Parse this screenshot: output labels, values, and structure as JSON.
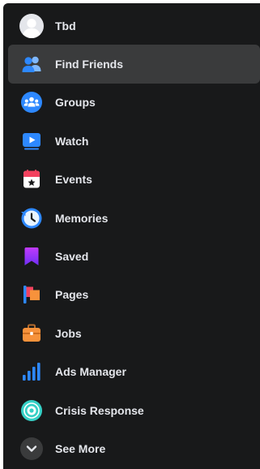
{
  "menu": {
    "items": [
      {
        "id": "profile",
        "label": "Tbd",
        "icon": "avatar"
      },
      {
        "id": "find-friends",
        "label": "Find Friends",
        "icon": "friends-icon"
      },
      {
        "id": "groups",
        "label": "Groups",
        "icon": "groups-icon"
      },
      {
        "id": "watch",
        "label": "Watch",
        "icon": "watch-icon"
      },
      {
        "id": "events",
        "label": "Events",
        "icon": "events-icon"
      },
      {
        "id": "memories",
        "label": "Memories",
        "icon": "memories-icon"
      },
      {
        "id": "saved",
        "label": "Saved",
        "icon": "saved-icon"
      },
      {
        "id": "pages",
        "label": "Pages",
        "icon": "pages-icon"
      },
      {
        "id": "jobs",
        "label": "Jobs",
        "icon": "jobs-icon"
      },
      {
        "id": "ads-manager",
        "label": "Ads Manager",
        "icon": "ads-manager-icon"
      },
      {
        "id": "crisis-response",
        "label": "Crisis Response",
        "icon": "crisis-response-icon"
      },
      {
        "id": "see-more",
        "label": "See More",
        "icon": "chevron-down-icon"
      }
    ],
    "active_item": "find-friends"
  },
  "colors": {
    "panel_bg": "#18191a",
    "active_bg": "#3a3b3c",
    "text": "#e4e6eb",
    "blue": "#2d88ff",
    "red": "#f3425f",
    "orange": "#f7923b",
    "purple": "#a33bfc",
    "teal": "#35d0c6"
  }
}
